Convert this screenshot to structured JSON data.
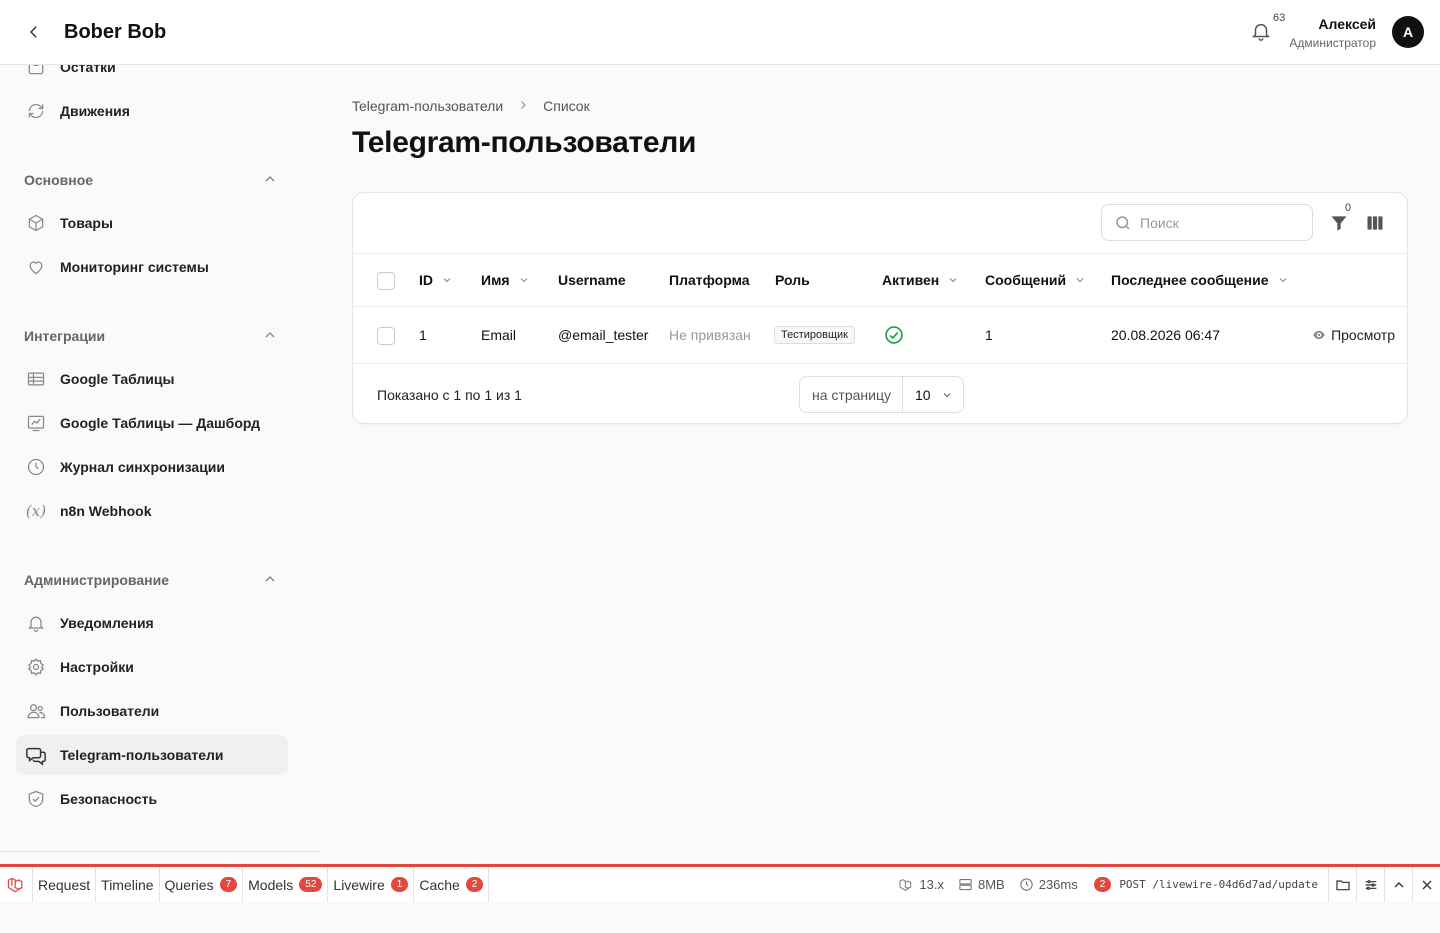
{
  "header": {
    "brand": "Bober Bob",
    "notifications_count": "63",
    "user_name": "Алексей",
    "user_role": "Администратор",
    "avatar_initial": "A"
  },
  "sidebar": {
    "top_items": [
      {
        "label": "Остатки",
        "icon": "box-icon"
      },
      {
        "label": "Движения",
        "icon": "refresh-icon"
      }
    ],
    "groups": [
      {
        "title": "Основное",
        "items": [
          {
            "label": "Товары",
            "icon": "cube-icon"
          },
          {
            "label": "Мониторинг системы",
            "icon": "heart-icon"
          }
        ]
      },
      {
        "title": "Интеграции",
        "items": [
          {
            "label": "Google Таблицы",
            "icon": "table-icon"
          },
          {
            "label": "Google Таблицы — Дашборд",
            "icon": "chart-icon"
          },
          {
            "label": "Журнал синхронизации",
            "icon": "clock-icon"
          },
          {
            "label": "n8n Webhook",
            "icon": "variable-icon"
          }
        ]
      },
      {
        "title": "Администрирование",
        "items": [
          {
            "label": "Уведомления",
            "icon": "bell-icon"
          },
          {
            "label": "Настройки",
            "icon": "gear-icon"
          },
          {
            "label": "Пользователи",
            "icon": "users-icon"
          },
          {
            "label": "Telegram-пользователи",
            "icon": "chat-icon",
            "active": true
          },
          {
            "label": "Безопасность",
            "icon": "shield-icon"
          }
        ]
      }
    ]
  },
  "breadcrumb": {
    "parent": "Telegram-пользователи",
    "current": "Список"
  },
  "page_title": "Telegram-пользователи",
  "table": {
    "search_placeholder": "Поиск",
    "filter_count": "0",
    "columns": [
      "ID",
      "Имя",
      "Username",
      "Платформа",
      "Роль",
      "Активен",
      "Сообщений",
      "Последнее сообщение"
    ],
    "rows": [
      {
        "id": "1",
        "name": "Email",
        "username": "@email_tester",
        "platform": "Не привязан",
        "role": "Тестировщик",
        "active": true,
        "messages": "1",
        "last_message": "20.08.2026 06:47",
        "action": "Просмотр"
      }
    ],
    "footer_text": "Показано с 1 по 1 из 1",
    "per_page_label": "на страницу",
    "per_page_value": "10"
  },
  "debugbar": {
    "tabs": [
      {
        "label": "Request"
      },
      {
        "label": "Timeline"
      },
      {
        "label": "Queries",
        "count": "7"
      },
      {
        "label": "Models",
        "count": "52"
      },
      {
        "label": "Livewire",
        "count": "1"
      },
      {
        "label": "Cache",
        "count": "2"
      }
    ],
    "version": "13.x",
    "memory": "8MB",
    "time": "236ms",
    "request_count": "2",
    "request_url": "POST /livewire-04d6d7ad/update"
  },
  "colors": {
    "accent_red": "#e4483c",
    "success_green": "#16a34a"
  }
}
